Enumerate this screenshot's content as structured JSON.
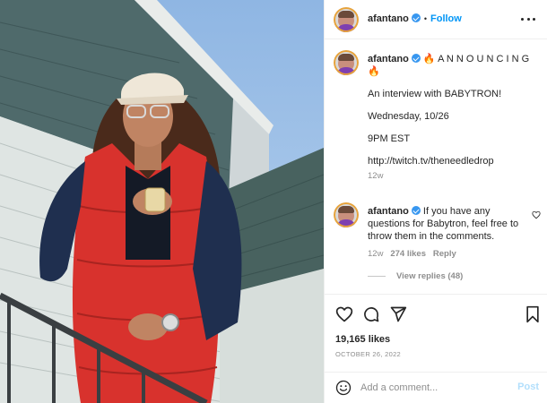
{
  "post_header": {
    "username": "afantano",
    "separator": "•",
    "follow_label": "Follow"
  },
  "caption": {
    "username": "afantano",
    "fire_emoji": "🔥",
    "announcing": "A N N O U N C I N G",
    "line1": "An interview with BABYTRON!",
    "line2": "Wednesday, 10/26",
    "line3": "9PM EST",
    "link": "http://twitch.tv/theneedledrop",
    "time": "12w"
  },
  "comment": {
    "username": "afantano",
    "text": "If you have any questions for Babytron, feel free to throw them in the comments.",
    "time": "12w",
    "likes": "274 likes",
    "reply_label": "Reply",
    "view_replies": "View replies (48)"
  },
  "stats": {
    "likes": "19,165 likes",
    "date": "OCTOBER 26, 2022"
  },
  "add_comment": {
    "placeholder": "Add a comment...",
    "post_label": "Post"
  },
  "icons": {
    "like": "heart-icon",
    "comment": "comment-icon",
    "share": "send-icon",
    "save": "bookmark-icon",
    "emoji": "emoji-icon",
    "verified": "verified-badge-icon",
    "more": "more-options-icon"
  },
  "colors": {
    "link_blue": "#0095f6",
    "post_disabled": "#b2dffc",
    "muted": "#8e8e8e",
    "verified": "#3897f0"
  }
}
